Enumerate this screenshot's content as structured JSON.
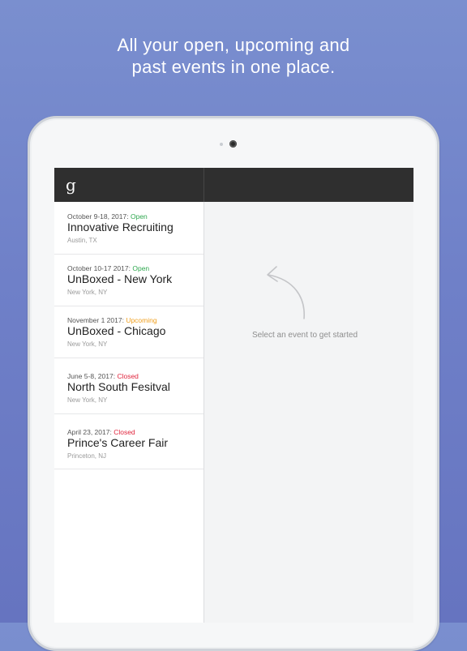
{
  "headline": {
    "line1": "All your open, upcoming and",
    "line2": "past events in one place."
  },
  "app": {
    "logo_text": "g"
  },
  "events": [
    {
      "dates": "October 9-18, 2017:",
      "status": "Open",
      "status_color": "#2fa84f",
      "name": "Innovative Recruiting",
      "location": "Austin, TX"
    },
    {
      "dates": "October 10-17 2017:",
      "status": "Open",
      "status_color": "#2fa84f",
      "name": "UnBoxed - New York",
      "location": "New York, NY"
    },
    {
      "dates": "November 1 2017:",
      "status": "Upcoming",
      "status_color": "#f0a020",
      "name": "UnBoxed - Chicago",
      "location": "New York, NY"
    },
    {
      "dates": "June 5-8, 2017:",
      "status": "Closed",
      "status_color": "#e0263e",
      "name": "North South Fesitval",
      "location": "New York, NY"
    },
    {
      "dates": "April 23, 2017:",
      "status": "Closed",
      "status_color": "#e0263e",
      "name": "Prince's Career Fair",
      "location": "Princeton, NJ"
    }
  ],
  "detail": {
    "empty_hint": "Select an event to get started",
    "hint_icon": "curved-arrow-up-left-icon"
  }
}
